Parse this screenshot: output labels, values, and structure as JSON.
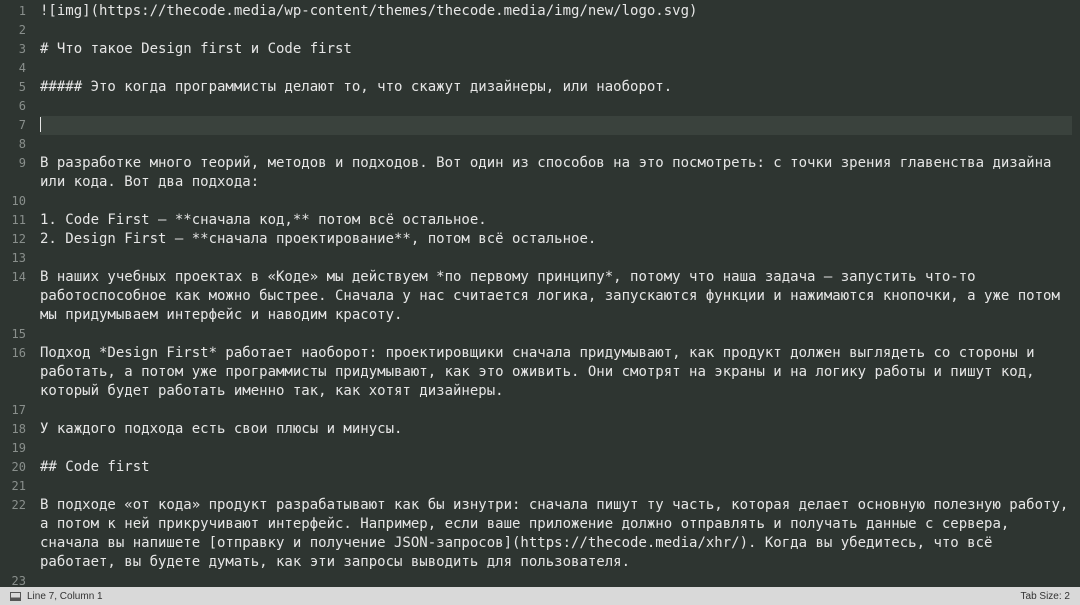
{
  "lines": [
    {
      "n": 1,
      "text": "![img](https://thecode.media/wp-content/themes/thecode.media/img/new/logo.svg)"
    },
    {
      "n": 2,
      "text": ""
    },
    {
      "n": 3,
      "text": "# Что такое Design first и Code first"
    },
    {
      "n": 4,
      "text": ""
    },
    {
      "n": 5,
      "text": "##### Это когда программисты делают то, что скажут дизайнеры, или наоборот."
    },
    {
      "n": 6,
      "text": ""
    },
    {
      "n": 7,
      "text": "",
      "current": true
    },
    {
      "n": 8,
      "text": ""
    },
    {
      "n": 9,
      "text": "В разработке много теорий, методов и подходов. Вот один из способов на это посмотреть: с точки зрения главенства дизайна или кода. Вот два подхода:"
    },
    {
      "n": 10,
      "text": ""
    },
    {
      "n": 11,
      "text": "1. Code First — **сначала код,** потом всё остальное."
    },
    {
      "n": 12,
      "text": "2. Design First — **сначала проектирование**, потом всё остальное."
    },
    {
      "n": 13,
      "text": ""
    },
    {
      "n": 14,
      "text": "В наших учебных проектах в «Коде» мы действуем *по первому принципу*, потому что наша задача — запустить что-то работоспособное как можно быстрее. Сначала у нас считается логика, запускаются функции и нажимаются кнопочки, а уже потом мы придумываем интерфейс и наводим красоту."
    },
    {
      "n": 15,
      "text": ""
    },
    {
      "n": 16,
      "text": "Подход *Design First* работает наоборот: проектировщики сначала придумывают, как продукт должен выглядеть со стороны и работать, а потом уже программисты придумывают, как это оживить. Они смотрят на экраны и на логику работы и пишут код, который будет работать именно так, как хотят дизайнеры."
    },
    {
      "n": 17,
      "text": ""
    },
    {
      "n": 18,
      "text": "У каждого подхода есть свои плюсы и минусы."
    },
    {
      "n": 19,
      "text": ""
    },
    {
      "n": 20,
      "text": "## Code first"
    },
    {
      "n": 21,
      "text": ""
    },
    {
      "n": 22,
      "text": "В подходе «от кода» продукт разрабатывают как бы изнутри: сначала пишут ту часть, которая делает основную полезную работу, а потом к ней прикручивают интерфейс. Например, если ваше приложение должно отправлять и получать данные с сервера, сначала вы напишете [отправку и получение JSON-запросов](https://thecode.media/xhr/). Когда вы убедитесь, что всё работает, вы будете думать, как эти запросы выводить для пользователя."
    },
    {
      "n": 23,
      "text": ""
    }
  ],
  "status": {
    "position": "Line 7, Column 1",
    "tabsize": "Tab Size: 2"
  }
}
